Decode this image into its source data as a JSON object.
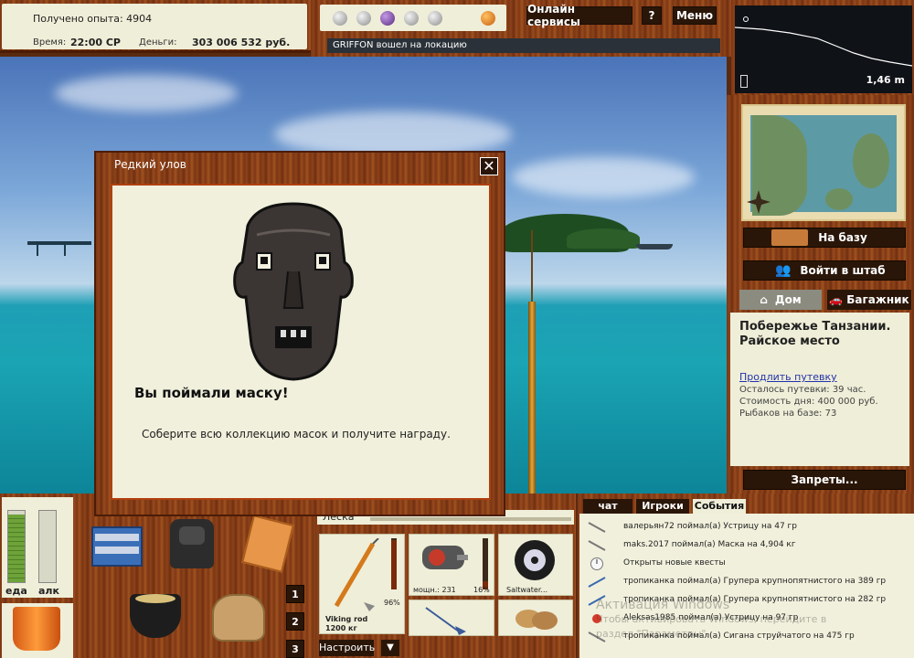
{
  "status": {
    "experience": "Получено опыта: 4904",
    "time_label": "Время:",
    "time_value": "22:00 СР",
    "money_label": "Деньги:",
    "money_value": "303 006 532 руб."
  },
  "top": {
    "online_services": "Онлайн сервисы",
    "help": "?",
    "menu": "Меню",
    "notice": "GRIFFON вошел на локацию"
  },
  "depth": {
    "value": "1,46 m"
  },
  "right": {
    "to_base": "На базу",
    "to_hq": "Войти в штаб",
    "tab_home": "Дом",
    "tab_trunk": "Багажник",
    "location_title": "Побережье Танзании. Райское место",
    "extend_link": "Продлить путевку",
    "remaining": "Осталось путевки: 39 час.",
    "day_cost": "Стоимость дня: 400 000 руб.",
    "fishers": "Рыбаков на базе: 73",
    "bans": "Запреты..."
  },
  "dialog": {
    "title": "Редкий улов",
    "close": "✕",
    "heading": "Вы поймали маску!",
    "text": "Соберите всю коллекцию масок и получите награду."
  },
  "gauges": {
    "food_label": "еда",
    "alc_label": "алк",
    "food_level": 0.95,
    "alc_level": 0.0
  },
  "numbers": [
    "1",
    "2",
    "3"
  ],
  "tackle": {
    "line_label": "Леска",
    "rod_name": "Viking rod",
    "rod_weight": "1200 кг",
    "rod_pct": "96%",
    "reel_power": "мощн.: 231",
    "reel_pct": "16%",
    "line_name": "Saltwater...",
    "setup": "Настроить",
    "down": "▼"
  },
  "events": {
    "tabs": [
      "чат",
      "Игроки",
      "События"
    ],
    "rows": [
      "валерьян72 поймал(а) Устрицу на 47 гр",
      "maks.2017 поймал(а) Маска на 4,904 кг",
      "Открыты новые квесты",
      "тропиканка поймал(а) Групера крупнопятнистого на 389 гр",
      "тропиканка поймал(а) Групера крупнопятнистого на 282 гр",
      "Aleksas1985 поймал(а) Устрицу на 97 гр",
      "тропиканка поймал(а) Сигана струйчатого на 475 гр"
    ],
    "watermark_line1": "Активация Windows",
    "watermark_line2": "Чтобы активировать Windows, перейдите в",
    "watermark_line3": "раздел \"Параметры\"."
  }
}
